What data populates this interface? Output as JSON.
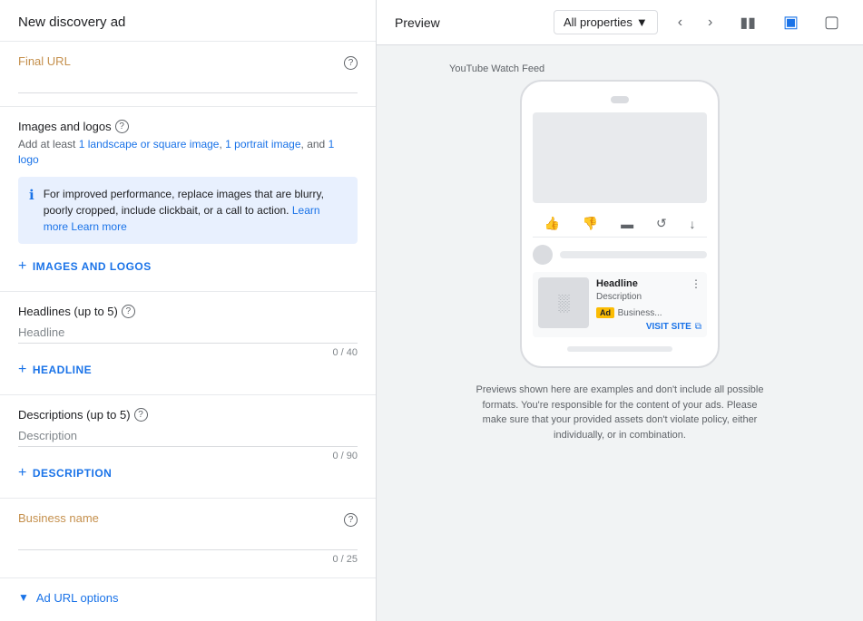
{
  "left": {
    "header": "New discovery ad",
    "final_url": {
      "label": "Final URL",
      "placeholder": "",
      "value": ""
    },
    "images_logos": {
      "title": "Images and logos",
      "subtitle_plain": "Add at least ",
      "subtitle_link1": "1 landscape or square image",
      "subtitle_mid": ", ",
      "subtitle_link2": "1 portrait image",
      "subtitle_end": ", and ",
      "subtitle_link3": "1 logo",
      "info_text": "For improved performance, replace images that are blurry, poorly cropped, include clickbait, or a call to action.",
      "info_link": "Learn more",
      "add_label": "IMAGES AND LOGOS"
    },
    "headlines": {
      "title": "Headlines (up to 5)",
      "placeholder": "Headline",
      "char_count": "0 / 40",
      "add_label": "HEADLINE"
    },
    "descriptions": {
      "title": "Descriptions (up to 5)",
      "placeholder": "Description",
      "char_count": "0 / 90",
      "add_label": "DESCRIPTION"
    },
    "business_name": {
      "label": "Business name",
      "placeholder": "",
      "value": "",
      "char_count": "0 / 25"
    },
    "ad_url_options": "Ad URL options"
  },
  "right": {
    "preview_title": "Preview",
    "properties_label": "All properties",
    "feed_label": "YouTube Watch Feed",
    "ad": {
      "headline": "Headline",
      "description": "Description",
      "badge": "Ad",
      "business": "Business...",
      "visit_site": "VISIT SITE"
    },
    "note": "Previews shown here are examples and don't include all possible formats. You're responsible for the content of your ads. Please make sure that your provided assets don't violate policy, either individually, or in combination."
  }
}
